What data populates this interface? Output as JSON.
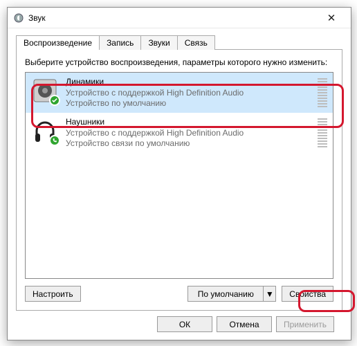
{
  "window": {
    "title": "Звук"
  },
  "tabs": [
    "Воспроизведение",
    "Запись",
    "Звуки",
    "Связь"
  ],
  "active_tab": 0,
  "instruction": "Выберите устройство воспроизведения, параметры которого нужно изменить:",
  "devices": [
    {
      "name": "Динамики",
      "sub1": "Устройство с поддержкой High Definition Audio",
      "sub2": "Устройство по умолчанию",
      "selected": true,
      "icon": "speakers",
      "badge": "check"
    },
    {
      "name": "Наушники",
      "sub1": "Устройство с поддержкой High Definition Audio",
      "sub2": "Устройство связи по умолчанию",
      "selected": false,
      "icon": "headphones",
      "badge": "phone"
    }
  ],
  "buttons": {
    "configure": "Настроить",
    "default": "По умолчанию",
    "properties": "Свойства",
    "ok": "ОК",
    "cancel": "Отмена",
    "apply": "Применить"
  }
}
